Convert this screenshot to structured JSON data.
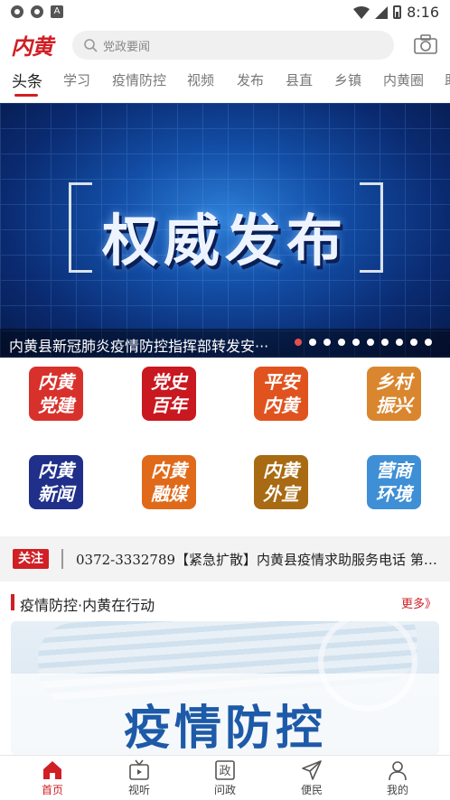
{
  "status_bar": {
    "time": "8:16",
    "notification_letter": "A"
  },
  "header": {
    "logo": "内黄",
    "search_placeholder": "党政要闻"
  },
  "tabs": [
    "头条",
    "学习",
    "疫情防控",
    "视频",
    "发布",
    "县直",
    "乡镇",
    "内黄圈",
    "助"
  ],
  "banner": {
    "headline": "权威发布",
    "caption": "内黄县新冠肺炎疫情防控指挥部转发安···",
    "slide_count": 10,
    "active_slide": 0
  },
  "icon_grid": [
    {
      "line1": "内黄",
      "line2": "党建",
      "color": "#d8312c"
    },
    {
      "line1": "党史",
      "line2": "百年",
      "color": "#c9181f"
    },
    {
      "line1": "平安",
      "line2": "内黄",
      "color": "#e0531f"
    },
    {
      "line1": "乡村",
      "line2": "振兴",
      "color": "#d9862e"
    },
    {
      "line1": "内黄",
      "line2": "新闻",
      "color": "#1f2f8a"
    },
    {
      "line1": "内黄",
      "line2": "融媒",
      "color": "#e06a1a"
    },
    {
      "line1": "内黄",
      "line2": "外宣",
      "color": "#a86a12"
    },
    {
      "line1": "营商",
      "line2": "环境",
      "color": "#3f8fd6"
    }
  ],
  "notice": {
    "badge": "关注",
    "text": "0372-3332789【紧急扩散】内黄县疫情求助服务电话 第一批"
  },
  "section": {
    "title": "疫情防控·内黄在行动",
    "more": "更多》",
    "feature_text": "疫情防控"
  },
  "bottom_nav": [
    {
      "label": "首页",
      "icon": "home-icon"
    },
    {
      "label": "视听",
      "icon": "tv-icon"
    },
    {
      "label": "问政",
      "icon": "zheng-icon"
    },
    {
      "label": "便民",
      "icon": "send-icon"
    },
    {
      "label": "我的",
      "icon": "user-icon"
    }
  ],
  "colors": {
    "brand_red": "#d01f25",
    "banner_blue": "#134ea6"
  }
}
